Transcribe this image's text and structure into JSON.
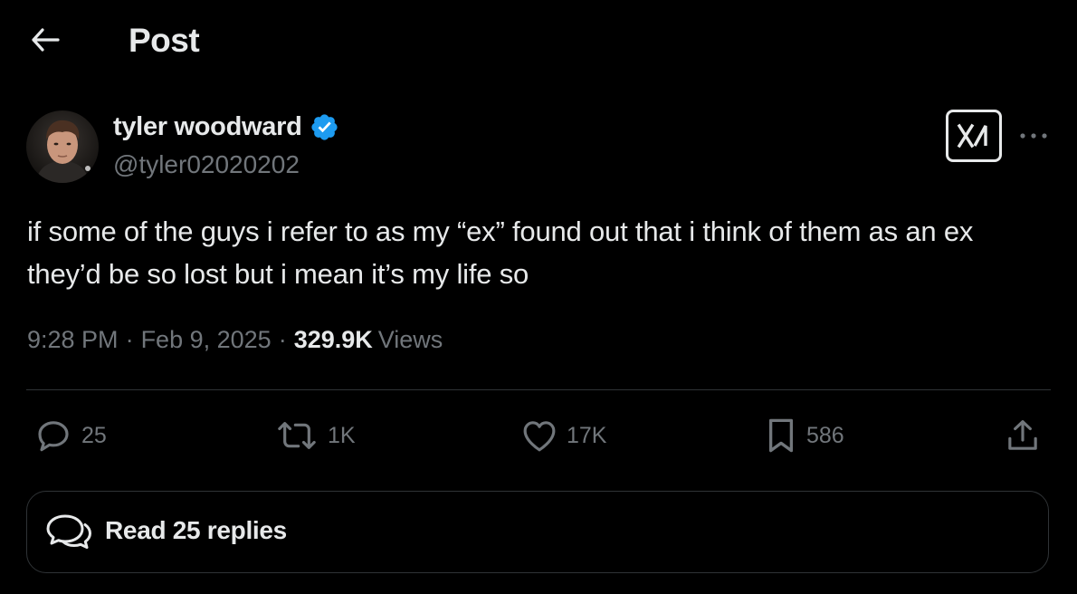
{
  "header": {
    "title": "Post",
    "back_icon": "arrow-left-icon"
  },
  "author": {
    "display_name": "tyler woodward",
    "handle": "@tyler02020202",
    "verified": true,
    "verified_color": "#1d9bf0",
    "avatar_icon": "profile-photo"
  },
  "actions_top": {
    "grok_icon": "grok-icon",
    "more_icon": "more-horizontal-icon"
  },
  "tweet": {
    "text": "if some of the guys i refer to as my “ex” found out that i think of them as an ex they’d be so lost but i mean it’s my life so",
    "time": "9:28 PM",
    "date": "Feb 9, 2025",
    "views_count": "329.9K",
    "views_label": "Views",
    "sep": "·"
  },
  "engagement": {
    "replies": "25",
    "reposts": "1K",
    "likes": "17K",
    "bookmarks": "586"
  },
  "replies_box": {
    "label": "Read 25 replies",
    "icon": "speech-bubbles-icon"
  },
  "colors": {
    "background": "#000000",
    "text": "#e7e9ea",
    "secondary": "#71767b",
    "border": "#2f3336"
  }
}
